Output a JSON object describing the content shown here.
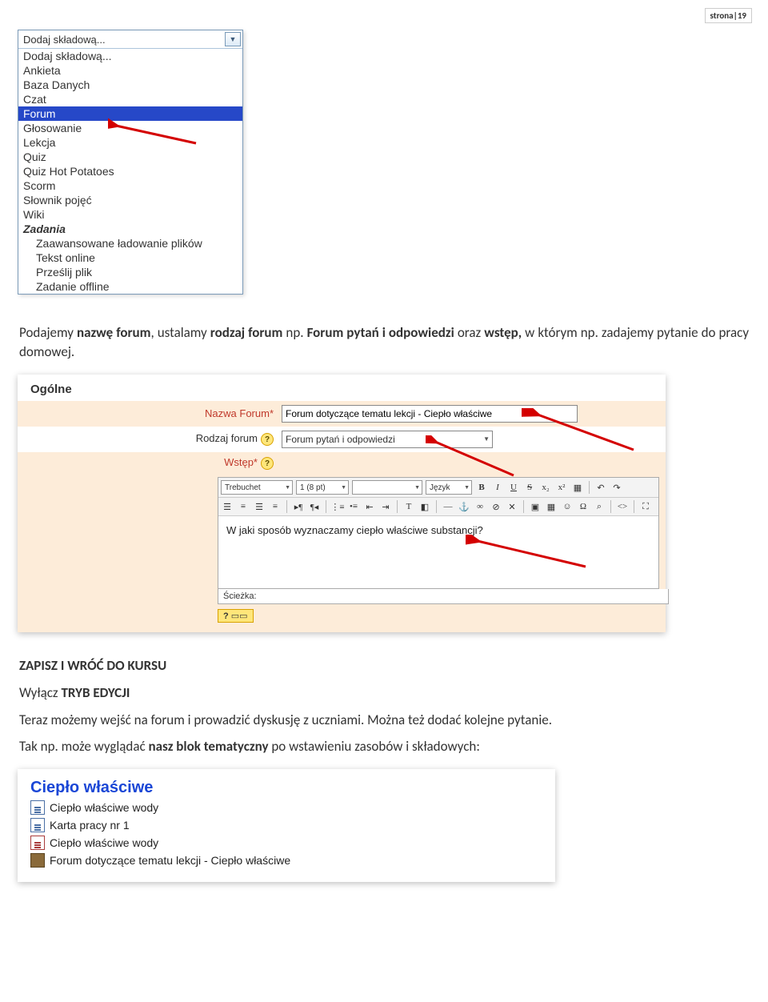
{
  "page_number": "strona|19",
  "dropdown": {
    "header": "Dodaj składową...",
    "groups": [
      {
        "type": "item",
        "label": "Dodaj składową..."
      },
      {
        "type": "item",
        "label": "Ankieta"
      },
      {
        "type": "item",
        "label": "Baza Danych"
      },
      {
        "type": "item",
        "label": "Czat"
      },
      {
        "type": "item",
        "label": "Forum",
        "highlight": true
      },
      {
        "type": "item",
        "label": "Głosowanie"
      },
      {
        "type": "item",
        "label": "Lekcja"
      },
      {
        "type": "item",
        "label": "Quiz"
      },
      {
        "type": "item",
        "label": "Quiz Hot Potatoes"
      },
      {
        "type": "item",
        "label": "Scorm"
      },
      {
        "type": "item",
        "label": "Słownik pojęć"
      },
      {
        "type": "item",
        "label": "Wiki"
      },
      {
        "type": "section",
        "label": "Zadania"
      },
      {
        "type": "sub",
        "label": "Zaawansowane ładowanie plików"
      },
      {
        "type": "sub",
        "label": "Tekst online"
      },
      {
        "type": "sub",
        "label": "Prześlij plik"
      },
      {
        "type": "sub",
        "label": "Zadanie offline"
      }
    ]
  },
  "para1": {
    "p1": "Podajemy ",
    "b1": "nazwę forum",
    "p2": ", ustalamy ",
    "b2": "rodzaj forum",
    "p3": " np. ",
    "b3": "Forum pytań i odpowiedzi",
    "p4": " oraz ",
    "b4": "wstęp,",
    "p5": " w którym np. zadajemy pytanie do pracy domowej."
  },
  "ogolne": {
    "legend": "Ogólne",
    "name_label": "Nazwa Forum*",
    "name_value": "Forum dotyczące tematu lekcji - Ciepło właściwe",
    "type_label": "Rodzaj forum",
    "type_value": "Forum pytań i odpowiedzi",
    "intro_label": "Wstęp*",
    "font": "Trebuchet",
    "size": "1 (8 pt)",
    "lang": "Język",
    "body": "W jaki sposób wyznaczamy ciepło właściwe substancji?",
    "path_label": "Ścieżka:",
    "help_label": "?"
  },
  "para2": {
    "h": "ZAPISZ I WRÓĆ DO KURSU",
    "l1a": "Wyłącz ",
    "l1b": "TRYB EDYCJI",
    "l2": "Teraz możemy wejść na forum i prowadzić dyskusję z uczniami. Można też dodać kolejne pytanie.",
    "l3a": "Tak np. może wyglądać ",
    "l3b": "nasz blok tematyczny",
    "l3c": " po wstawieniu zasobów i składowych:"
  },
  "block": {
    "title": "Ciepło właściwe",
    "items": [
      {
        "icon": "doc",
        "label": "Ciepło właściwe wody"
      },
      {
        "icon": "doc",
        "label": "Karta pracy nr 1"
      },
      {
        "icon": "pdf",
        "label": "Ciepło właściwe wody"
      },
      {
        "icon": "forum",
        "label": "Forum dotyczące tematu lekcji - Ciepło właściwe"
      }
    ]
  }
}
